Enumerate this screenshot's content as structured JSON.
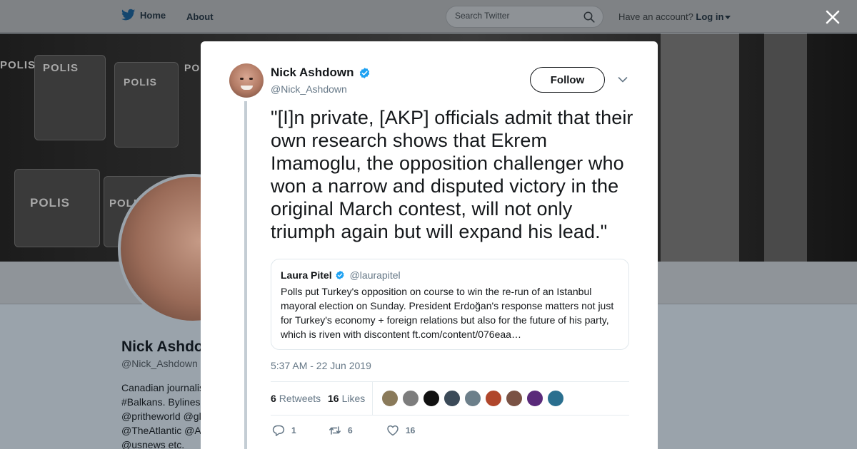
{
  "topbar": {
    "home_label": "Home",
    "about_label": "About",
    "search_placeholder": "Search Twitter",
    "account_prompt": "Have an account?",
    "login_label": "Log in"
  },
  "banner": {
    "signs": [
      "POLIS",
      "POLIS",
      "POLIS",
      "POLIS",
      "POLIS",
      "POLIS"
    ]
  },
  "profile": {
    "name": "Nick Ashdown",
    "handle": "@Nick_Ashdown",
    "bio_lines": [
      "Canadian journalist",
      "#Balkans. Bylines",
      "@pritheworld @gl",
      "@TheAtlantic @A",
      "@usnews etc."
    ]
  },
  "tweet": {
    "author_name": "Nick Ashdown",
    "author_handle": "@Nick_Ashdown",
    "follow_label": "Follow",
    "text": "\"[I]n private, [AKP] officials admit that their own research shows that Ekrem Imamoglu, the opposition challenger who won a narrow and disputed victory in the original March contest, will not only triumph again but will expand his lead.\"",
    "timestamp": "5:37 AM - 22 Jun 2019",
    "retweets_count": "6",
    "retweets_label": "Retweets",
    "likes_count": "16",
    "likes_label": "Likes",
    "liker_colors": [
      "#8a7a5a",
      "#7d7d7d",
      "#111111",
      "#3b4a58",
      "#6c7f8a",
      "#b0462b",
      "#7a5244",
      "#5a2a7a",
      "#2a6f8f"
    ]
  },
  "quote": {
    "name": "Laura Pitel",
    "handle": "@laurapitel",
    "text": "Polls put Turkey's opposition on course to win the re-run of an Istanbul mayoral election on Sunday. President Erdoğan's response matters not just for Turkey's economy + foreign relations but also for the future of his party, which is riven with discontent ft.com/content/076eaa…"
  },
  "actions": {
    "replies": "1",
    "retweets": "6",
    "likes": "16"
  },
  "colors": {
    "accent": "#1da1f2",
    "muted": "#657786"
  }
}
